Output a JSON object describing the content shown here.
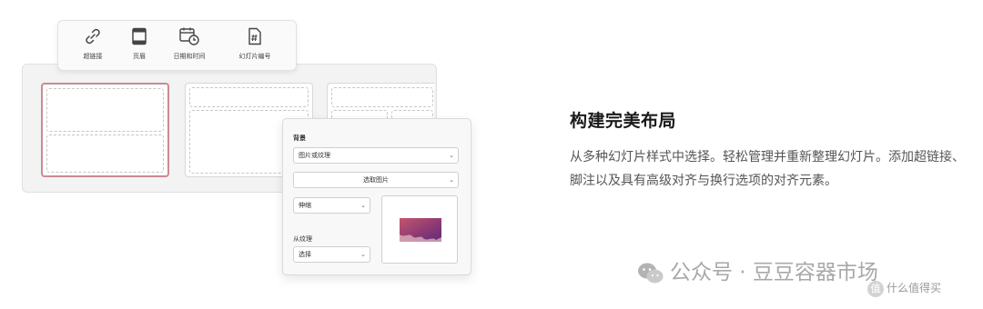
{
  "toolbar": {
    "items": [
      {
        "label": "超链接",
        "icon": "link-icon"
      },
      {
        "label": "页眉",
        "icon": "header-icon"
      },
      {
        "label": "日期和时间",
        "icon": "calendar-clock-icon"
      },
      {
        "label": "幻灯片编号",
        "icon": "slide-number-icon"
      }
    ]
  },
  "background_panel": {
    "title": "背景",
    "fill_type": {
      "value": "图片或纹理"
    },
    "pick_image_button": "选取图片",
    "stretch": {
      "value": "伸缩"
    },
    "texture_label": "从纹理",
    "texture_select": {
      "value": "选择"
    }
  },
  "feature": {
    "heading": "构建完美布局",
    "description": "从多种幻灯片样式中选择。轻松管理并重新整理幻灯片。添加超链接、脚注以及具有高级对齐与换行选项的对齐元素。"
  },
  "watermark": {
    "primary": "公众号 · 豆豆容器市场",
    "secondary_badge": "值",
    "secondary": "什么值得买"
  },
  "colors": {
    "selected_border": "#c98b93",
    "preview_image_top": "#b04b6a",
    "preview_image_bottom": "#6a2f7a"
  }
}
